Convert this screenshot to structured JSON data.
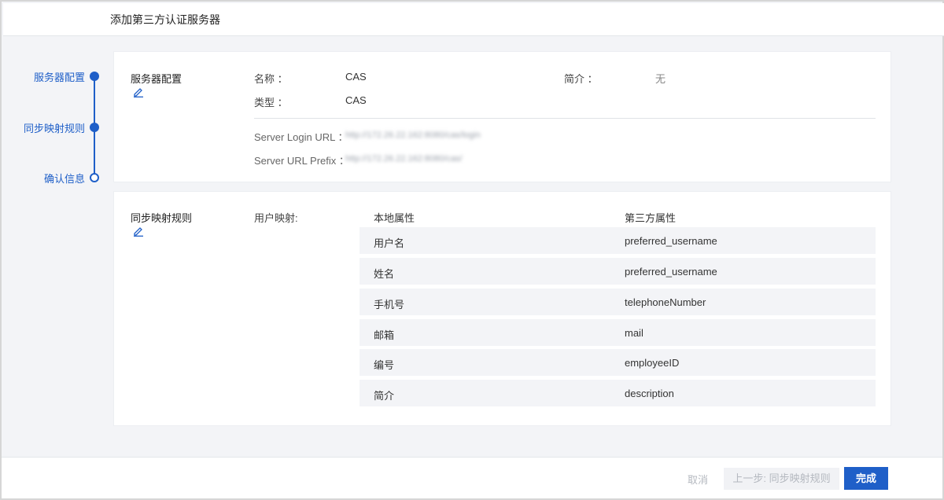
{
  "header": {
    "title": "添加第三方认证服务器"
  },
  "steps": [
    {
      "label": "服务器配置",
      "state": "done"
    },
    {
      "label": "同步映射规则",
      "state": "done"
    },
    {
      "label": "确认信息",
      "state": "current"
    }
  ],
  "server_config": {
    "section_title": "服务器配置",
    "name_label": "名称 ：",
    "name_value": "CAS",
    "desc_label": "简介 ：",
    "desc_value": "无",
    "type_label": "类型 ：",
    "type_value": "CAS",
    "login_url_label": "Server Login URL ：",
    "login_url_value": "http://172.26.22.162:8080/cas/login",
    "url_prefix_label": "Server URL Prefix ：",
    "url_prefix_value": "http://172.26.22.162:8080/cas/"
  },
  "sync_rules": {
    "section_title": "同步映射规则",
    "mapping_label": "用户映射:",
    "col_local": "本地属性",
    "col_third": "第三方属性",
    "rows": [
      {
        "local": "用户名",
        "third": "preferred_username"
      },
      {
        "local": "姓名",
        "third": "preferred_username"
      },
      {
        "local": "手机号",
        "third": "telephoneNumber"
      },
      {
        "local": "邮箱",
        "third": "mail"
      },
      {
        "local": "编号",
        "third": "employeeID"
      },
      {
        "local": "简介",
        "third": "description"
      }
    ]
  },
  "footer": {
    "cancel_label": "取消",
    "prev_label": "上一步: 同步映射规则",
    "done_label": "完成"
  },
  "colors": {
    "accent": "#1f5fc8",
    "background": "#f3f4f7"
  }
}
